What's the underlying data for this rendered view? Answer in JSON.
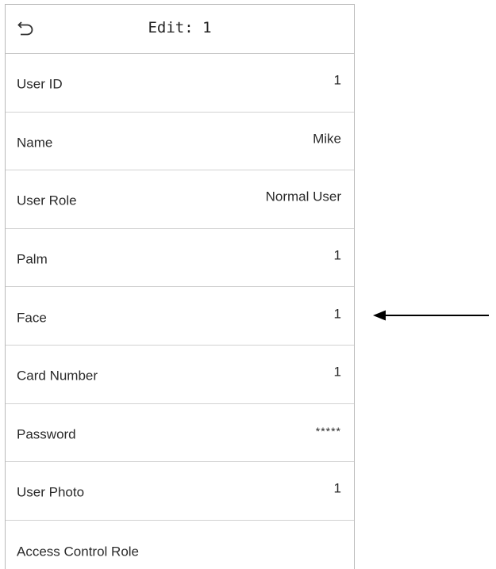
{
  "header": {
    "title": "Edit: 1",
    "back_icon": "return-arrow-icon"
  },
  "rows": [
    {
      "label": "User ID",
      "value": "1"
    },
    {
      "label": "Name",
      "value": "Mike"
    },
    {
      "label": "User Role",
      "value": "Normal User"
    },
    {
      "label": "Palm",
      "value": "1"
    },
    {
      "label": "Face",
      "value": "1"
    },
    {
      "label": "Card Number",
      "value": "1"
    },
    {
      "label": "Password",
      "value": "*****"
    },
    {
      "label": "User Photo",
      "value": "1"
    },
    {
      "label": "Access Control Role",
      "value": ""
    }
  ],
  "annotation": {
    "icon": "left-pointing-arrow-icon",
    "points_to": "Face"
  }
}
